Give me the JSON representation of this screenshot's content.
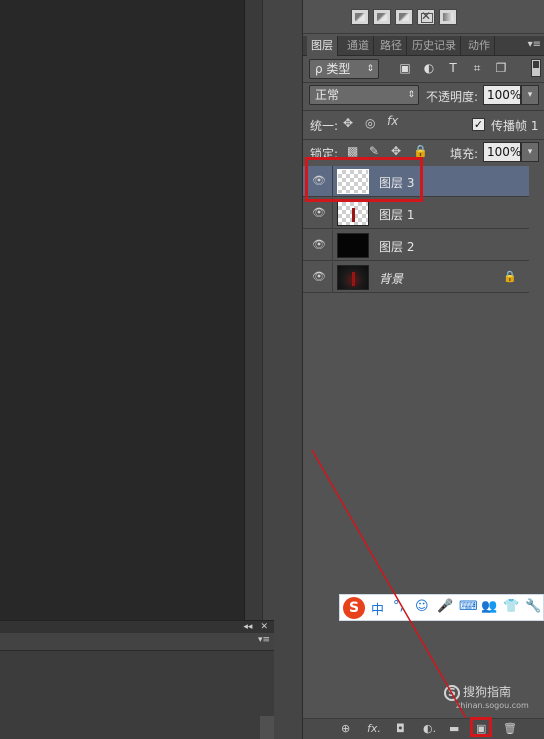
{
  "top_tools": [
    "style-preset-1",
    "style-preset-2",
    "style-preset-3",
    "style-preset-4",
    "style-preset-5"
  ],
  "tabs": [
    {
      "label": "图层",
      "active": true
    },
    {
      "label": "通道",
      "active": false
    },
    {
      "label": "路径",
      "active": false
    },
    {
      "label": "历史记录",
      "active": false
    },
    {
      "label": "动作",
      "active": false
    }
  ],
  "filter": {
    "label": "ρ 类型"
  },
  "blend": {
    "mode": "正常",
    "opacity_label": "不透明度:",
    "opacity": "100%"
  },
  "unify": {
    "label": "统一:",
    "propagate_label": "传播帧 1"
  },
  "lock": {
    "label": "锁定:",
    "fill_label": "填充:",
    "fill": "100%"
  },
  "layers": [
    {
      "name": "图层 3",
      "selected": true
    },
    {
      "name": "图层 1",
      "selected": false
    },
    {
      "name": "图层 2",
      "selected": false
    },
    {
      "name": "背景",
      "selected": false
    }
  ],
  "ime": {
    "items": [
      "中",
      "°,",
      "☺",
      "🎤",
      "⌨",
      "👥",
      "👕",
      "🔧"
    ]
  },
  "watermark": {
    "title": "搜狗指南",
    "subtitle": "zhinan.sogou.com"
  },
  "footer": [
    "⊕",
    "fx.",
    "◘",
    "◐.",
    "▬",
    "▣",
    "🗑"
  ],
  "colors": {
    "accent": "#d1161c",
    "selected_row": "#5d6a84"
  }
}
